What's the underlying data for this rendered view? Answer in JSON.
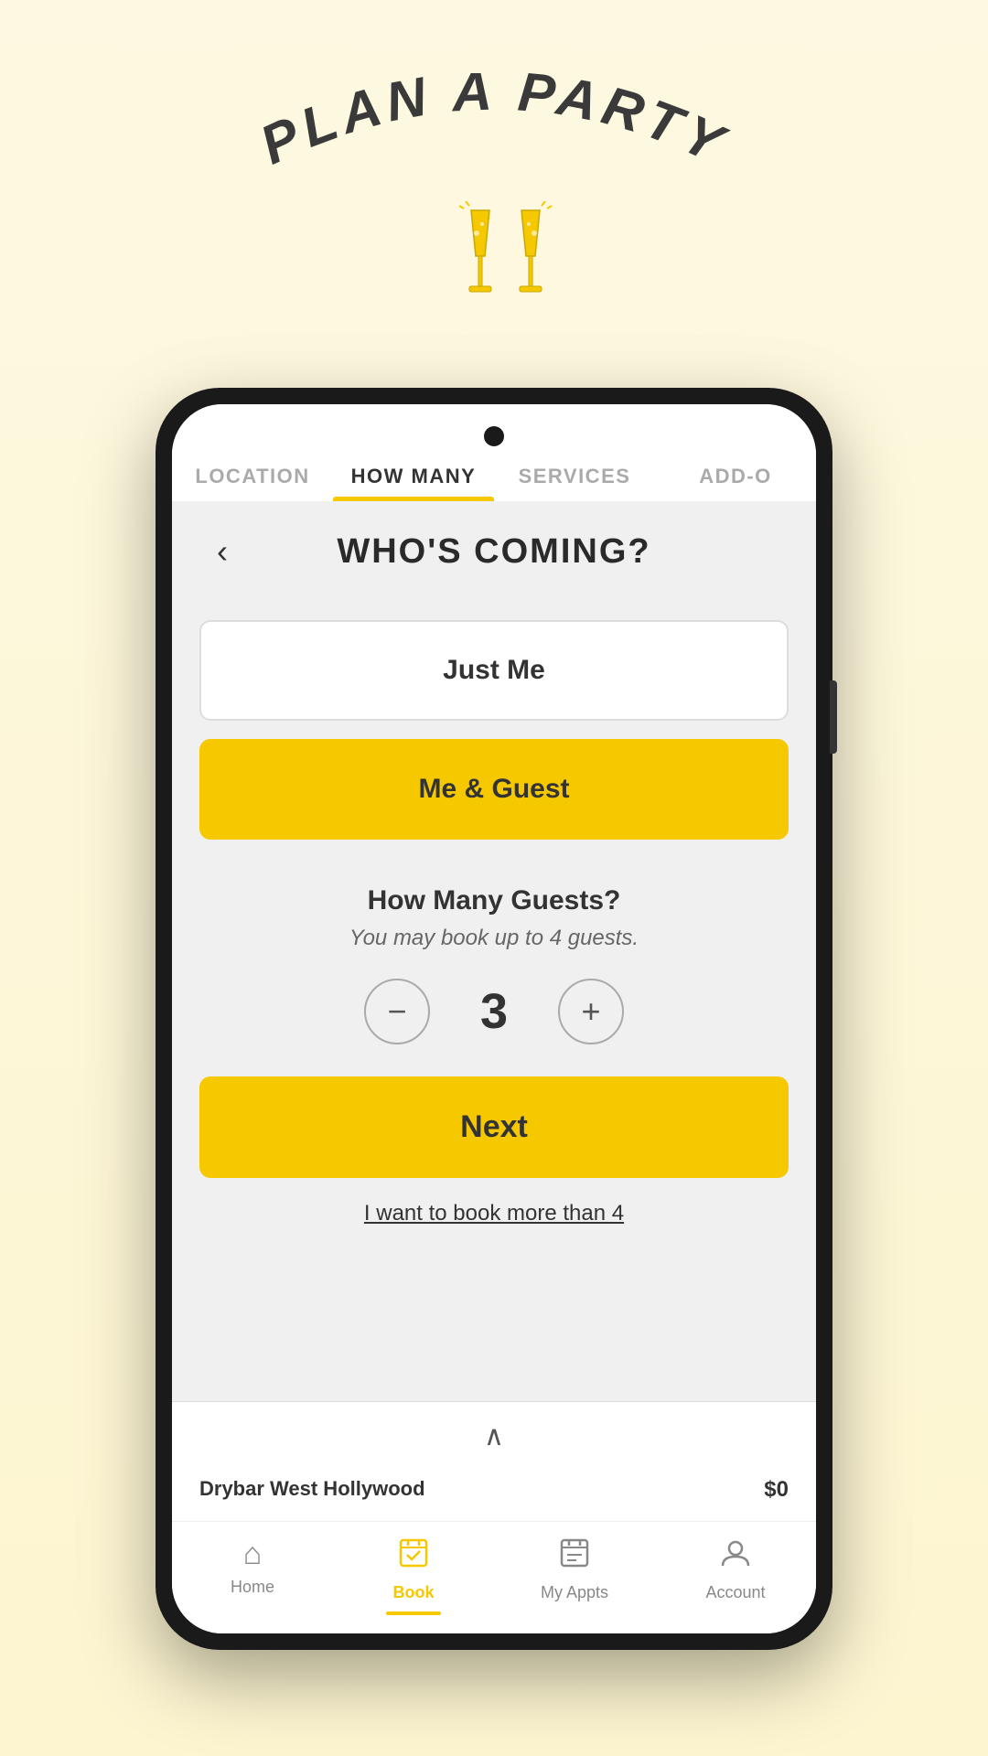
{
  "app": {
    "background_color": "#fdf8e1"
  },
  "top_section": {
    "title": "PLAN A PARTY",
    "champagne_emoji": "🥂"
  },
  "phone": {
    "tabs": [
      {
        "id": "location",
        "label": "LOCATION",
        "active": false
      },
      {
        "id": "how_many",
        "label": "HOW MANY",
        "active": true
      },
      {
        "id": "services",
        "label": "SERVICES",
        "active": false
      },
      {
        "id": "add_ons",
        "label": "ADD-O",
        "active": false
      }
    ],
    "page_title": "WHO'S COMING?",
    "back_label": "‹",
    "options": [
      {
        "id": "just_me",
        "label": "Just Me",
        "selected": false
      },
      {
        "id": "me_and_guest",
        "label": "Me & Guest",
        "selected": true
      }
    ],
    "guest_section": {
      "label": "How Many Guests?",
      "subtitle": "You may book up to 4 guests.",
      "count": "3",
      "decrement_icon": "−",
      "increment_icon": "+"
    },
    "next_button": "Next",
    "more_than_4": "I want to book more than 4",
    "bottom_bar": {
      "location": "Drybar West Hollywood",
      "price": "$0",
      "chevron": "∧"
    },
    "bottom_tabs": [
      {
        "id": "home",
        "label": "Home",
        "icon": "🏠",
        "active": false
      },
      {
        "id": "book",
        "label": "Book",
        "icon": "📅",
        "active": true
      },
      {
        "id": "my_appts",
        "label": "My Appts",
        "icon": "📋",
        "active": false
      },
      {
        "id": "account",
        "label": "Account",
        "icon": "👤",
        "active": false
      }
    ]
  }
}
